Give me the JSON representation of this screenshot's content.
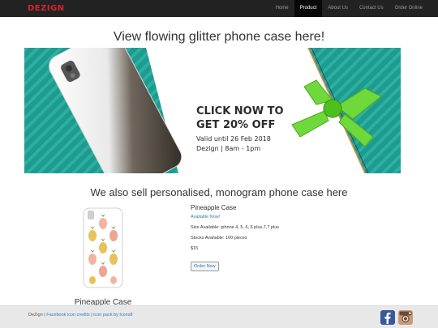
{
  "brand": "DEZIGN",
  "nav": {
    "items": [
      "Home",
      "Product",
      "About Us",
      "Contact Us",
      "Order Online"
    ],
    "active": "Product"
  },
  "headline": "View flowing glitter phone case here!",
  "banner": {
    "line1": "CLICK NOW TO",
    "line2": "GET 20% OFF",
    "line3": "Valid until 26 Feb 2018",
    "line4": "Dezign | 8am - 1pm"
  },
  "subheadline": "We also sell personalised, monogram phone case here",
  "product": {
    "caption": "Pineapple Case",
    "name": "Pineapple Case",
    "availability": "Available Now!",
    "sizes": "Size Available: iphone 4, 5, 6, 6 plus,7,7 plus",
    "stock": "Stocks Available: 100 pieces",
    "price": "$15",
    "order_label": "Order Now"
  },
  "footer": {
    "site": "DeZign",
    "sep": " | ",
    "link1": "Facebook icon credits",
    "link2": "icon pack by Icons8"
  },
  "colors": {
    "navbar": "#222222",
    "brand": "#d9232d",
    "banner_teal": "#1e9a8e",
    "ribbon_green": "#6fd83a",
    "link": "#337ab7"
  },
  "icons": [
    "facebook-icon",
    "instagram-icon"
  ]
}
